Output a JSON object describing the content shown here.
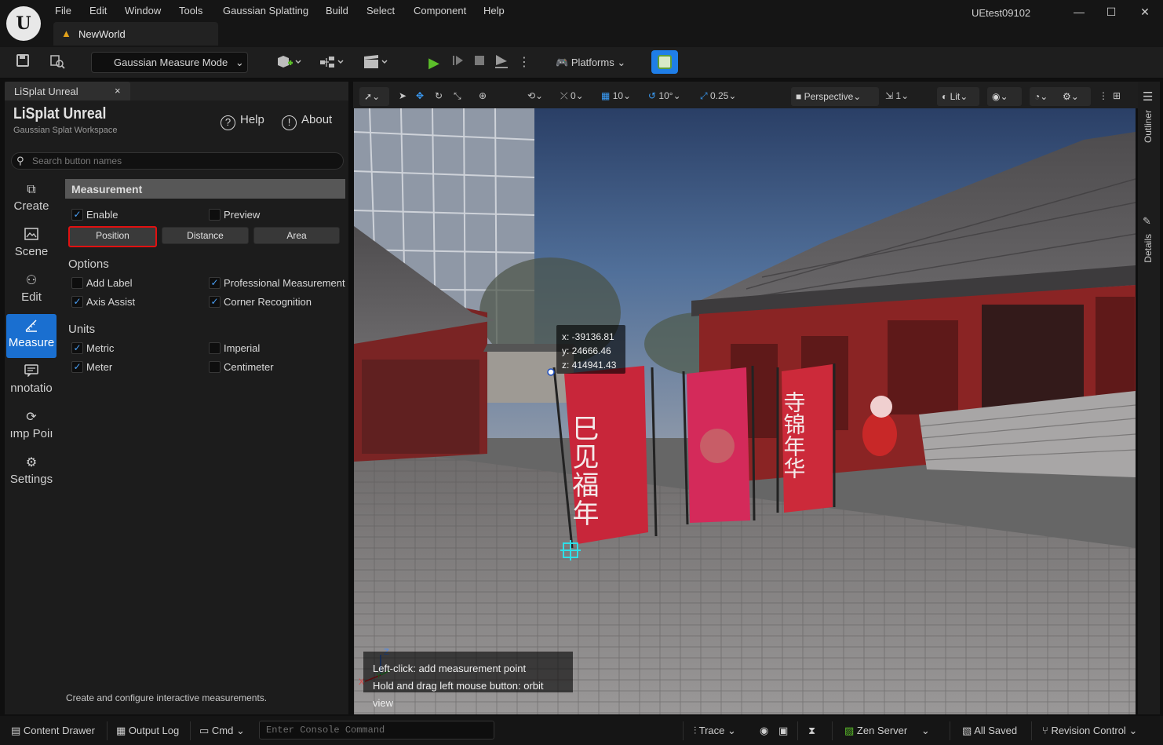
{
  "titlebar": {
    "menu": [
      "File",
      "Edit",
      "Window",
      "Tools",
      "Gaussian Splatting",
      "Build",
      "Select",
      "Component",
      "Help"
    ],
    "project": "UEtest09102",
    "map_tab": "NewWorld",
    "min_glyph": "—",
    "max_glyph": "☐",
    "close_glyph": "✕"
  },
  "toolbar": {
    "mode": "Gaussian Measure Mode",
    "platforms": "Platforms"
  },
  "panel": {
    "tab_label": "LiSplat Unreal",
    "tab_close": "×",
    "title": "LiSplat Unreal",
    "subtitle": "Gaussian Splat Workspace",
    "help": "Help",
    "about": "About",
    "search_placeholder": "Search button names",
    "nav": [
      {
        "label": "Create",
        "icon": "⧉"
      },
      {
        "label": "Scene",
        "icon": "🖼"
      },
      {
        "label": "Edit",
        "icon": "⚇"
      },
      {
        "label": "Measure",
        "icon": "📐"
      },
      {
        "label": "nnotatio",
        "icon": "☰"
      },
      {
        "label": "ımp Poiı",
        "icon": "⟳"
      },
      {
        "label": "Settings",
        "icon": "⚙"
      }
    ],
    "section_title": "Measurement",
    "enable": {
      "label": "Enable",
      "checked": true
    },
    "preview": {
      "label": "Preview",
      "checked": false
    },
    "modes": [
      "Position",
      "Distance",
      "Area"
    ],
    "options_title": "Options",
    "options": [
      {
        "label": "Add Label",
        "checked": false
      },
      {
        "label": "Professional Measurement",
        "checked": true
      },
      {
        "label": "Axis Assist",
        "checked": true
      },
      {
        "label": "Corner Recognition",
        "checked": true
      }
    ],
    "units_title": "Units",
    "units": [
      {
        "label": "Metric",
        "checked": true
      },
      {
        "label": "Imperial",
        "checked": false
      },
      {
        "label": "Meter",
        "checked": true
      },
      {
        "label": "Centimeter",
        "checked": false
      }
    ],
    "footer": "Create and configure interactive measurements."
  },
  "viewport_toolbar": {
    "rot_val": "0",
    "grid_val": "10",
    "angle_val": "10°",
    "scale_val": "0.25",
    "perspective": "Perspective",
    "camera_speed": "1",
    "lit": "Lit"
  },
  "side": {
    "outliner": "Outliner",
    "details": "Details"
  },
  "viewport": {
    "readout": {
      "x": "x: -39136.81",
      "y": "y: 24666.46",
      "z": "z: 414941.43"
    },
    "hint1": "Left-click: add measurement point",
    "hint2": "Hold and drag left mouse button: orbit view",
    "banner1": "巳见福年",
    "banner3": "寺锦年华",
    "axis_z": "Z",
    "axis_y": "Y",
    "axis_x": "X"
  },
  "statusbar": {
    "content_drawer": "Content Drawer",
    "output_log": "Output Log",
    "cmd": "Cmd",
    "console_placeholder": "Enter Console Command",
    "trace": "Trace",
    "zen": "Zen Server",
    "saved": "All Saved",
    "revision": "Revision Control"
  },
  "colors": {
    "accent": "#1a6fd0",
    "highlight": "#e01010",
    "play": "#5cbf2a"
  }
}
